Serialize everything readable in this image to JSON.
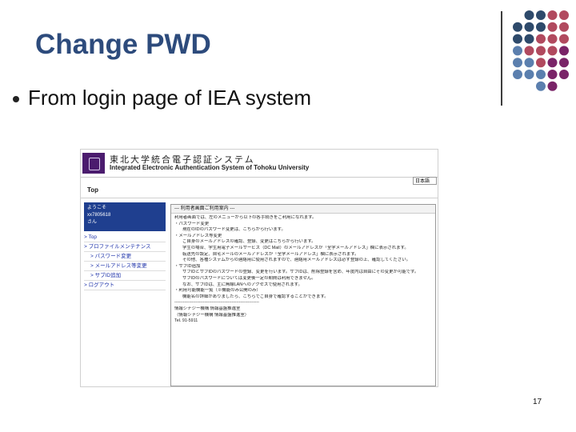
{
  "slide": {
    "title": "Change PWD",
    "bullet": "From login page of IEA system",
    "page_number": "17"
  },
  "screenshot": {
    "brand_jp": "東北大学統合電子認証システム",
    "brand_en": "Integrated Electronic Authentication System of Tohoku University",
    "language_select": "日本語",
    "breadcrumb": "Top",
    "user_box": [
      "ようこそ",
      "xx7805618",
      "さん"
    ],
    "menu": [
      {
        "label": "> Top",
        "sub": false
      },
      {
        "label": "> プロファイルメンテナンス",
        "sub": false
      },
      {
        "label": "> パスワード変更",
        "sub": true
      },
      {
        "label": "> メールアドレス等変更",
        "sub": true
      },
      {
        "label": "> サブID追加",
        "sub": true
      },
      {
        "label": "> ログアウト",
        "sub": false
      }
    ],
    "content_heading": "--- 利用者画面ご利用案内 ---",
    "content_lines": [
      {
        "t": "利用者画面では、左のメニューから以下の各手続きをご利用になれます。",
        "i": false
      },
      {
        "t": "・パスワード変更",
        "i": false
      },
      {
        "t": "現在のIDのパスワード変更は、こちらから行います。",
        "i": true
      },
      {
        "t": "・メールアドレス等変更",
        "i": false
      },
      {
        "t": "ご自身のメールアドレスの確認、登録、変更はこちらから行います。",
        "i": true
      },
      {
        "t": "学生の場合、学生用電子メールサービス（DC Mail）のメールアドレスが「全学メールアドレス」欄に表示されます。",
        "i": true
      },
      {
        "t": "転送先の設定、自宅メールのメールアドレスが「全学メールアドレス」欄に表示されます。",
        "i": true
      },
      {
        "t": "その他、各種システムからの連絡用に使用されますので、連絡用メールアドレスは必ず登録の上、確認してください。",
        "i": true
      },
      {
        "t": "・サブID追加",
        "i": false
      },
      {
        "t": "サブIDとサブIDのパスワードの登録、変更を行います。サブIDは、削除登録を含め、年度内は自由にその変更が可能です。",
        "i": true
      },
      {
        "t": "サブIDのパスワードについては変更後一定の期間は利用できません。",
        "i": true
      },
      {
        "t": "なお、サブIDは、主に無線LANへのアクセスで使用されます。",
        "i": true
      },
      {
        "t": "・利用可能機能一覧（※機能のみ公開のみ）",
        "i": false
      },
      {
        "t": "機能名の詳細がありましたら、こちらでご自身で確認することができます。",
        "i": true
      },
      {
        "t": "-----------------------------------------------------------",
        "i": false
      },
      {
        "t": "情報シナジー機構 情報基盤推進室",
        "i": false
      },
      {
        "t": "（情報シナジー機構 情報基盤推進室）",
        "i": false
      },
      {
        "t": "Tel. 91-5911",
        "i": false
      }
    ]
  },
  "colors": {
    "title": "#2d4b7c",
    "dot_rose": "#b14a5f",
    "dot_blue": "#5b7fae",
    "dot_navy": "#2e4a6b",
    "dot_purple": "#7a2468",
    "user_box": "#1f3f8f",
    "logo": "#4b1c6e"
  }
}
